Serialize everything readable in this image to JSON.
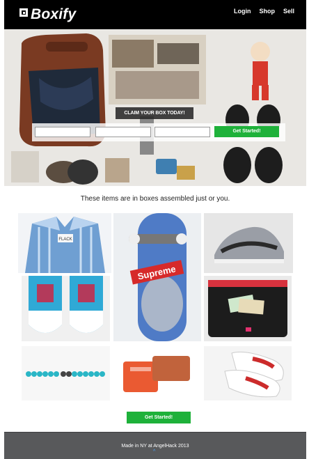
{
  "brand": {
    "name": "Boxify"
  },
  "nav": {
    "login": "Login",
    "shop": "Shop",
    "sell": "Sell"
  },
  "hero": {
    "claim_label": "CLAIM YOUR BOX TODAY!",
    "field1_placeholder": "",
    "field2_placeholder": "",
    "field3_placeholder": "",
    "cta_label": "Get Started!"
  },
  "main": {
    "tagline": "These items are in boxes assembled just or you.",
    "cta_label": "Get Started!"
  },
  "product_labels": {
    "skateboard_brand": "Supreme",
    "shirt_tag": "FLACK"
  },
  "footer": {
    "text": "Made in NY at AngelHack 2013",
    "caret": "^"
  },
  "colors": {
    "accent_green": "#1eb13a",
    "navbar": "#000000",
    "footer": "#58595b"
  }
}
